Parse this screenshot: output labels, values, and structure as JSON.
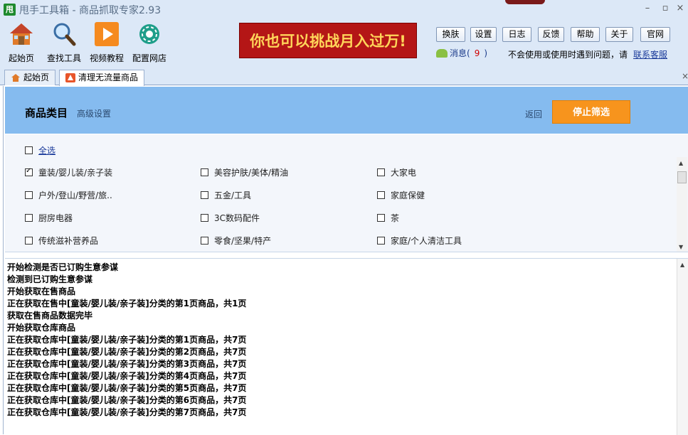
{
  "window": {
    "app_icon_text": "甩",
    "title": "甩手工具箱 - 商品抓取专家2.93",
    "min": "–",
    "max": "▫",
    "close": "×"
  },
  "toolbar": {
    "tools": [
      {
        "label": "起始页"
      },
      {
        "label": "查找工具"
      },
      {
        "label": "视频教程"
      },
      {
        "label": "配置网店"
      }
    ],
    "banner": "你也可以挑战月入过万!",
    "buttons": [
      "换肤",
      "设置",
      "日志",
      "反馈",
      "帮助",
      "关于",
      "官网"
    ],
    "message_label": "消息(",
    "message_count": "9",
    "message_close": ")",
    "help_text": "不会使用或使用时遇到问题，请",
    "help_link": "联系客服"
  },
  "tabs": [
    {
      "label": "起始页"
    },
    {
      "label": "清理无流量商品"
    }
  ],
  "tab_close": "×",
  "category": {
    "title": "商品类目",
    "subtitle": "高级设置",
    "back": "返回",
    "stop_button": "停止筛选",
    "select_all": "全选",
    "items": [
      {
        "label": "童装/婴儿装/亲子装",
        "checked": true
      },
      {
        "label": "美容护肤/美体/精油",
        "checked": false
      },
      {
        "label": "大家电",
        "checked": false
      },
      {
        "label": "户外/登山/野营/旅..",
        "checked": false
      },
      {
        "label": "五金/工具",
        "checked": false
      },
      {
        "label": "家庭保健",
        "checked": false
      },
      {
        "label": "厨房电器",
        "checked": false
      },
      {
        "label": "3C数码配件",
        "checked": false
      },
      {
        "label": "茶",
        "checked": false
      },
      {
        "label": "传统滋补营养品",
        "checked": false
      },
      {
        "label": "零食/坚果/特产",
        "checked": false
      },
      {
        "label": "家庭/个人清洁工具",
        "checked": false
      }
    ]
  },
  "log": [
    "开始检测是否已订购生意参谋",
    "检测到已订购生意参谋",
    "开始获取在售商品",
    "正在获取在售中[童装/婴儿装/亲子装]分类的第1页商品，共1页",
    "获取在售商品数据完毕",
    "开始获取仓库商品",
    "正在获取仓库中[童装/婴儿装/亲子装]分类的第1页商品，共7页",
    "正在获取仓库中[童装/婴儿装/亲子装]分类的第2页商品，共7页",
    "正在获取仓库中[童装/婴儿装/亲子装]分类的第3页商品，共7页",
    "正在获取仓库中[童装/婴儿装/亲子装]分类的第4页商品，共7页",
    "正在获取仓库中[童装/婴儿装/亲子装]分类的第5页商品，共7页",
    "正在获取仓库中[童装/婴儿装/亲子装]分类的第6页商品，共7页",
    "正在获取仓库中[童装/婴儿装/亲子装]分类的第7页商品，共7页"
  ]
}
